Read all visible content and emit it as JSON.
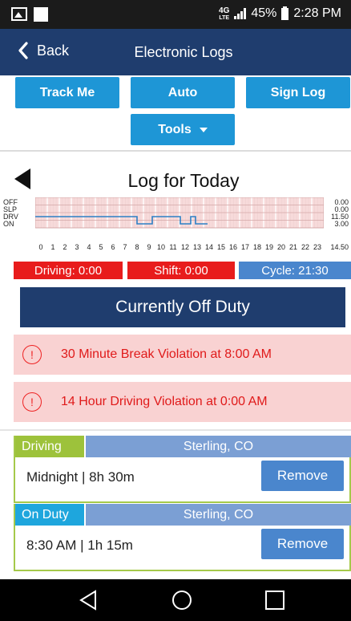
{
  "status_bar": {
    "network": "4G",
    "network_sub": "LTE",
    "battery": "45%",
    "time": "2:28 PM"
  },
  "nav": {
    "back_label": "Back",
    "title": "Electronic Logs"
  },
  "buttons": {
    "track_me": "Track Me",
    "auto": "Auto",
    "sign_log": "Sign Log",
    "tools": "Tools"
  },
  "log": {
    "title": "Log for Today",
    "row_labels": [
      "OFF",
      "SLP",
      "DRV",
      "ON"
    ],
    "row_totals": [
      "0.00",
      "0.00",
      "11.50",
      "3.00"
    ],
    "grand_total": "14.50",
    "hour_ticks": [
      "0",
      "1",
      "2",
      "3",
      "4",
      "5",
      "6",
      "7",
      "8",
      "9",
      "10",
      "11",
      "12",
      "13",
      "14",
      "15",
      "16",
      "17",
      "18",
      "19",
      "20",
      "21",
      "22",
      "23"
    ]
  },
  "stats": {
    "driving": "Driving: 0:00",
    "shift": "Shift: 0:00",
    "cycle": "Cycle: 21:30"
  },
  "duty_status": "Currently Off Duty",
  "violations": [
    {
      "text": "30 Minute Break Violation at 8:00 AM"
    },
    {
      "text": "14 Hour Driving Violation at 0:00 AM"
    }
  ],
  "entries": [
    {
      "status": "Driving",
      "location": "Sterling, CO",
      "time": "Midnight | 8h 30m",
      "action": "Remove"
    },
    {
      "status": "On Duty",
      "location": "Sterling, CO",
      "time": "8:30 AM | 1h 15m",
      "action": "Remove"
    }
  ],
  "colors": {
    "navy": "#1f3d6e",
    "button_blue": "#1e96d6",
    "alert_red": "#e81c1c",
    "violation_bg": "#f9d2d2",
    "driving_green": "#9dc23b",
    "onduty_blue": "#1ea6dd",
    "location_blue": "#7b9fd4"
  }
}
